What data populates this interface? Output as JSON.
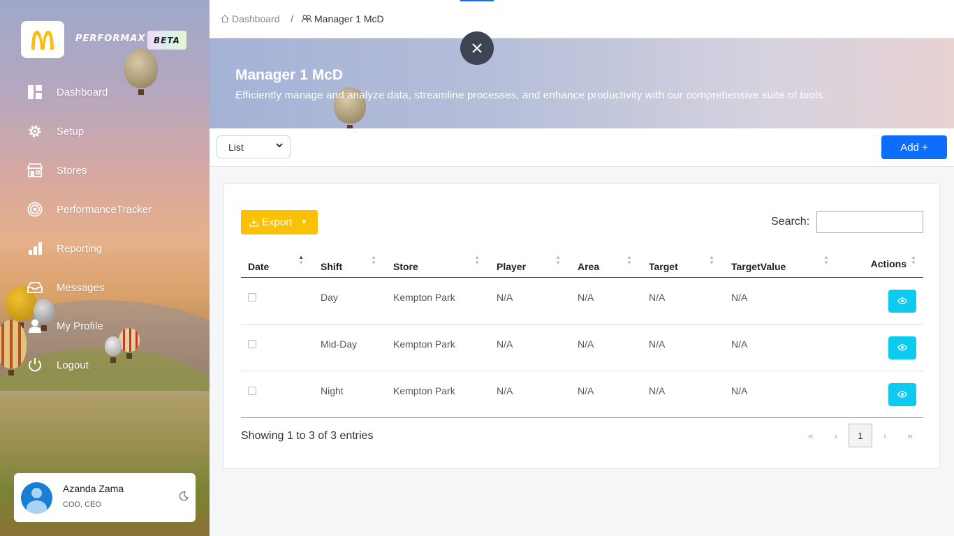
{
  "brand": {
    "name": "PERFORMAX",
    "badge": "BETA"
  },
  "sidebar": {
    "items": [
      {
        "label": "Dashboard",
        "icon": "dashboard-icon"
      },
      {
        "label": "Setup",
        "icon": "gear-icon"
      },
      {
        "label": "Stores",
        "icon": "store-icon"
      },
      {
        "label": "PerformanceTracker",
        "icon": "target-icon"
      },
      {
        "label": "Reporting",
        "icon": "bar-chart-icon"
      },
      {
        "label": "Messages",
        "icon": "inbox-icon"
      },
      {
        "label": "My Profile",
        "icon": "user-icon"
      },
      {
        "label": "Logout",
        "icon": "power-icon"
      }
    ]
  },
  "user": {
    "name": "Azanda Zama",
    "role": "COO, CEO"
  },
  "breadcrumb": {
    "home": "Dashboard",
    "separator": "/",
    "current": "Manager 1 McD"
  },
  "hero": {
    "title": "Manager 1 McD",
    "subtitle": "Efficiently manage and analyze data, streamline processes, and enhance productivity with our comprehensive suite of tools."
  },
  "toolbar": {
    "view_select": "List",
    "add_label": "Add +"
  },
  "table_controls": {
    "export_label": "Export",
    "search_label": "Search:"
  },
  "table": {
    "columns": [
      "Date",
      "Shift",
      "Store",
      "Player",
      "Area",
      "Target",
      "TargetValue",
      "Actions"
    ],
    "rows": [
      {
        "shift": "Day",
        "store": "Kempton Park",
        "player": "N/A",
        "area": "N/A",
        "target": "N/A",
        "target_value": "N/A"
      },
      {
        "shift": "Mid-Day",
        "store": "Kempton Park",
        "player": "N/A",
        "area": "N/A",
        "target": "N/A",
        "target_value": "N/A"
      },
      {
        "shift": "Night",
        "store": "Kempton Park",
        "player": "N/A",
        "area": "N/A",
        "target": "N/A",
        "target_value": "N/A"
      }
    ]
  },
  "footer": {
    "showing": "Showing 1 to 3 of 3 entries"
  },
  "pagination": {
    "first": "«",
    "prev": "‹",
    "current": "1",
    "next": "›",
    "last": "»"
  },
  "colors": {
    "primary": "#0d6efd",
    "export": "#fbc105",
    "info": "#0dcaf0",
    "mcd_yellow": "#ffbc0d"
  }
}
